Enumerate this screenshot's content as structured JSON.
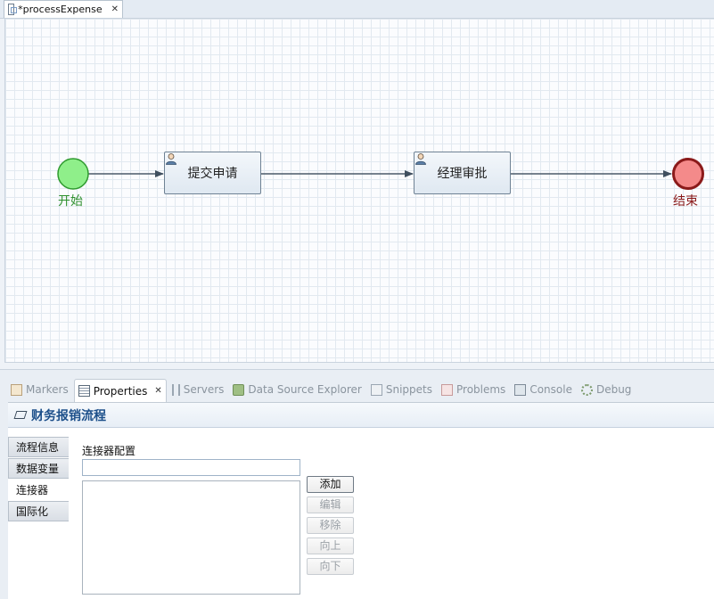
{
  "editor": {
    "tab_title": "*processExpense",
    "diagram": {
      "start_event": "开始",
      "end_event": "结束",
      "tasks": [
        "提交申请",
        "经理审批"
      ]
    }
  },
  "views": {
    "tabs": [
      {
        "label": "Markers",
        "icon": "markers-icon"
      },
      {
        "label": "Properties",
        "icon": "properties-icon",
        "active": true
      },
      {
        "label": "Servers",
        "icon": "servers-icon"
      },
      {
        "label": "Data Source Explorer",
        "icon": "data-source-icon"
      },
      {
        "label": "Snippets",
        "icon": "snippets-icon"
      },
      {
        "label": "Problems",
        "icon": "problems-icon"
      },
      {
        "label": "Console",
        "icon": "console-icon"
      },
      {
        "label": "Debug",
        "icon": "debug-icon"
      }
    ]
  },
  "properties": {
    "title": "财务报销流程",
    "side_tabs": [
      "流程信息",
      "数据变量",
      "连接器",
      "国际化"
    ],
    "active_side_tab": "连接器",
    "connector": {
      "label": "连接器配置",
      "input_value": "",
      "buttons": {
        "add": "添加",
        "edit": "编辑",
        "remove": "移除",
        "up": "向上",
        "down": "向下"
      }
    }
  },
  "colors": {
    "start_fill": "#8fef8a",
    "start_stroke": "#2f9a2f",
    "end_fill": "#f48a8a",
    "end_stroke": "#8b1a1a",
    "title_color": "#1c4f8a"
  }
}
